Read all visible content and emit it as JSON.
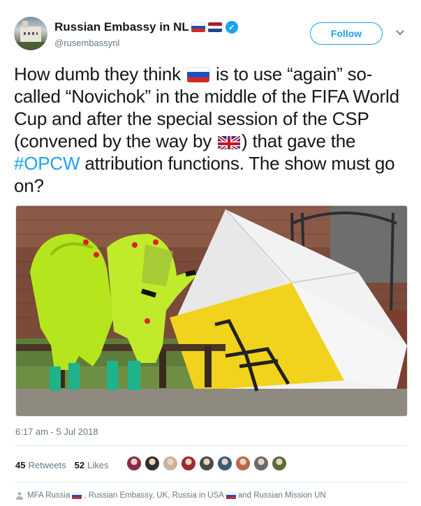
{
  "author": {
    "display_name": "Russian Embassy in NL",
    "handle": "@rusembassynl",
    "verified": true
  },
  "follow_label": "Follow",
  "tweet": {
    "part1": "How dumb they think ",
    "part2": " is to use “again” so-called “Novichok” in the middle of the FIFA World Cup and after the special session of the CSP (convened by the way by ",
    "part3": ") that gave the ",
    "hashtag": "#OPCW",
    "part4": " attribution functions. The show must go on?"
  },
  "timestamp": "6:17 am - 5 Jul 2018",
  "stats": {
    "retweets_count": "45",
    "retweets_label": "Retweets",
    "likes_count": "52",
    "likes_label": "Likes"
  },
  "likers": [
    "#8a2b4a",
    "#2f2f2f",
    "#c7b39a",
    "#9c2a2a",
    "#4a4a4a",
    "#3b5b7a",
    "#b56a4a",
    "#6a6a6a",
    "#5b6b3a"
  ],
  "context_line": {
    "t1": "MFA Russia",
    "t2": ", Russian Embassy, UK, Russia in USA",
    "t3": "and Russian Mission UN"
  },
  "colors": {
    "accent": "#1da1f2",
    "text": "#14171a",
    "muted": "#657786"
  },
  "icons": [
    "verified-icon",
    "chevron-down-icon",
    "person-icon"
  ]
}
